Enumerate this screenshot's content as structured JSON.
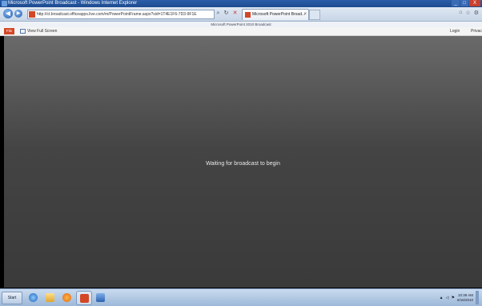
{
  "window": {
    "title": "Microsoft PowerPoint Broadcast - Windows Internet Explorer",
    "controls": {
      "minimize": "_",
      "maximize": "□",
      "close": "X"
    }
  },
  "browser": {
    "back_icon": "back-arrow-icon",
    "forward_icon": "forward-arrow-icon",
    "address": "http://ct.broadcast.officeapps.live.com/m/PowerPointFrame.aspx?sid=1T4E1F6-7D3-9F1E",
    "tab_label": "Microsoft PowerPoint Broad...",
    "tab_close": "×"
  },
  "banner": {
    "title": "Microsoft PowerPoint 2010 Broadcast"
  },
  "toolbar": {
    "file_label": "File",
    "view_fullscreen_label": "View Full Screen",
    "login_label": "Login",
    "privacy_label": "Privacy"
  },
  "stage": {
    "message": "Waiting for broadcast to begin"
  },
  "taskbar": {
    "start_label": "Start",
    "apps": [
      "internet-explorer-icon",
      "windows-explorer-icon",
      "media-player-icon",
      "powerpoint-icon",
      "paint-icon"
    ],
    "clock_time": "10:39 AM",
    "clock_date": "6/16/2010"
  },
  "colors": {
    "accent": "#d24726",
    "title_bar": "#2b5ea8",
    "stage_top": "#6a6a6a",
    "stage_bottom": "#3a3a3a"
  }
}
